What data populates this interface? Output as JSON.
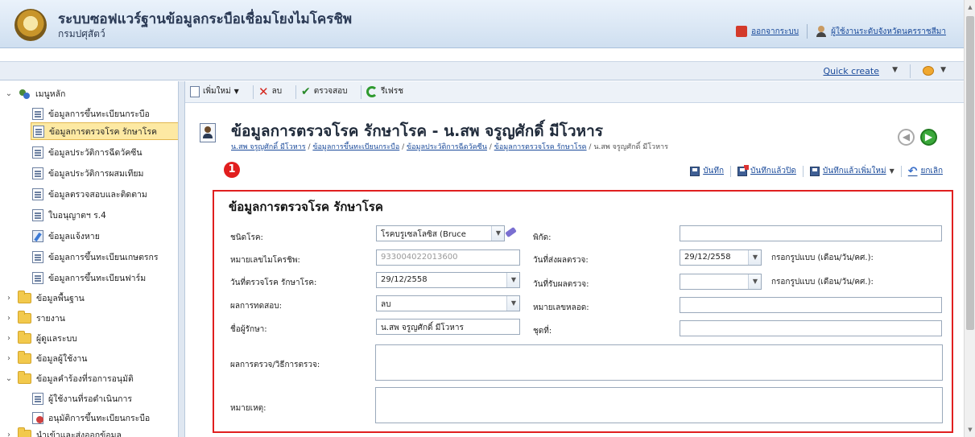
{
  "header": {
    "app_title": "ระบบซอฟแวร์ฐานข้อมูลกระบือเชื่อมโยงไมโครชิพ",
    "app_subtitle": "กรมปศุสัตว์",
    "logout_label": "ออกจากระบบ",
    "user_label": "ผู้ใช้งานระดับจังหวัดนครราชสีมา"
  },
  "quick_bar": {
    "quick_create_label": "Quick create"
  },
  "sidebar": {
    "root_label": "เมนูหลัก",
    "items": [
      {
        "label": "ข้อมูลการขึ้นทะเบียนกระบือ",
        "icon": "document-icon"
      },
      {
        "label": "ข้อมูลการตรวจโรค รักษาโรค",
        "icon": "document-icon",
        "selected": true
      },
      {
        "label": "ข้อมูลประวัติการฉีดวัคซีน",
        "icon": "document-icon"
      },
      {
        "label": "ข้อมูลประวัติการผสมเทียม",
        "icon": "document-icon"
      },
      {
        "label": "ข้อมูลตรวจสอบและติดตาม",
        "icon": "document-icon"
      },
      {
        "label": "ใบอนุญาตฯ ร.4",
        "icon": "document-icon"
      },
      {
        "label": "ข้อมูลแจ้งหาย",
        "icon": "edit-icon"
      },
      {
        "label": "ข้อมูลการขึ้นทะเบียนเกษตรกร",
        "icon": "document-icon"
      },
      {
        "label": "ข้อมูลการขึ้นทะเบียนฟาร์ม",
        "icon": "document-icon"
      }
    ],
    "folders": [
      {
        "label": "ข้อมูลพื้นฐาน",
        "expanded": false
      },
      {
        "label": "รายงาน",
        "expanded": false
      },
      {
        "label": "ผู้ดูแลระบบ",
        "expanded": false
      },
      {
        "label": "ข้อมูลผู้ใช้งาน",
        "expanded": false
      },
      {
        "label": "ข้อมูลคำร้องที่รอการอนุมัติ",
        "expanded": true
      }
    ],
    "pending_items": [
      {
        "label": "ผู้ใช้งานที่รอดำเนินการ",
        "icon": "document-icon"
      },
      {
        "label": "อนุมัติการขึ้นทะเบียนกระบือ",
        "icon": "approve-icon"
      }
    ],
    "last_folder": {
      "label": "นำเข้าและส่งออกข้อมูล",
      "expanded": false
    }
  },
  "toolbar": {
    "new_label": "เพิ่มใหม่",
    "delete_label": "ลบ",
    "verify_label": "ตรวจสอบ",
    "refresh_label": "รีเฟรช"
  },
  "record": {
    "title": "ข้อมูลการตรวจโรค รักษาโรค - น.สพ จรูญศักดิ์ มีโวหาร",
    "breadcrumb": [
      "น.สพ จรูญศักดิ์ มีโวหาร",
      "ข้อมูลการขึ้นทะเบียนกระบือ",
      "ข้อมูลประวัติการฉีดวัคซีน",
      "ข้อมูลการตรวจโรค รักษาโรค",
      "น.สพ จรูญศักดิ์ มีโวหาร"
    ],
    "breadcrumb_sep": " / ",
    "step_badge": "1"
  },
  "save_bar": {
    "save_label": "บันทึก",
    "save_close_label": "บันทึกแล้วปิด",
    "save_new_label": "บันทึกแล้วเพิ่มใหม่",
    "cancel_label": "ยกเลิก"
  },
  "form": {
    "heading": "ข้อมูลการตรวจโรค รักษาโรค",
    "disease_type": {
      "label": "ชนิดโรค:",
      "value": "โรคบรูเซลโลซิส (Bruce"
    },
    "microchip": {
      "label": "หมายเลขไมโครชิพ:",
      "value": "933004022013600"
    },
    "exam_date": {
      "label": "วันที่ตรวจโรค รักษาโรค:",
      "value": "29/12/2558"
    },
    "test_result": {
      "label": "ผลการทดสอบ:",
      "value": "ลบ"
    },
    "treater": {
      "label": "ชื่อผู้รักษา:",
      "value": "น.สพ จรูญศักดิ์  มีโวหาร"
    },
    "exam_method": {
      "label": "ผลการตรวจ/วิธีการตรวจ:",
      "value": ""
    },
    "remark": {
      "label": "หมายเหตุ:",
      "value": ""
    },
    "coordinates": {
      "label": "พิกัด:",
      "value": ""
    },
    "sent_date": {
      "label": "วันที่ส่งผลตรวจ:",
      "value": "29/12/2558",
      "hint": "กรอกรูปแบบ (เดือน/วัน/คศ.):"
    },
    "received_date": {
      "label": "วันที่รับผลตรวจ:",
      "value": "",
      "hint": "กรอกรูปแบบ (เดือน/วัน/คศ.):"
    },
    "tube_no": {
      "label": "หมายเลขหลอด:",
      "value": ""
    },
    "set_no": {
      "label": "ชุดที่:",
      "value": ""
    }
  },
  "colors": {
    "highlight_border": "#e01f1f",
    "selected_item": "#fde9a3",
    "link": "#1a4a9a"
  }
}
